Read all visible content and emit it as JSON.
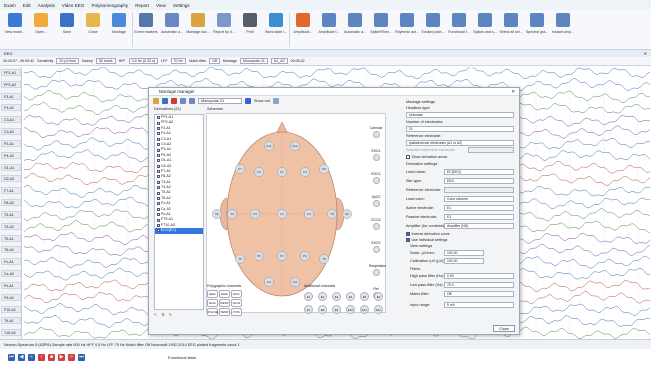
{
  "menu": [
    "Exam",
    "Edit",
    "Analysis",
    "Video EEG",
    "Polysomnography",
    "Report",
    "View",
    "Settings"
  ],
  "ribbon": [
    {
      "label": "New exam...",
      "color": "#3a7bd5"
    },
    {
      "label": "Open...",
      "color": "#f2a93b"
    },
    {
      "label": "Save",
      "color": "#3b72c4"
    },
    {
      "label": "Close",
      "color": "#e8b64c"
    },
    {
      "label": "Montage",
      "color": "#4a8ad8"
    },
    {
      "label": "Event markers",
      "color": "#5577aa"
    },
    {
      "label": "Automatic a...",
      "color": "#6a88c4"
    },
    {
      "label": "Montage wiz...",
      "color": "#d9a441"
    },
    {
      "label": "Report by d...",
      "color": "#7a99c9"
    },
    {
      "label": "Print",
      "color": "#555e6a"
    },
    {
      "label": "Work table i...",
      "color": "#3d8ed0"
    },
    {
      "label": "Amplitude...",
      "color": "#e06a2c"
    },
    {
      "label": "Amplitude t...",
      "color": "#5b86c0"
    },
    {
      "label": "Automatic a...",
      "color": "#5b86c0"
    },
    {
      "label": "Spike/Rhim...",
      "color": "#5b86c0"
    },
    {
      "label": "Rhythmic act...",
      "color": "#5b86c0"
    },
    {
      "label": "Evoked pote...",
      "color": "#5b86c0"
    },
    {
      "label": "Functional t...",
      "color": "#5b86c0"
    },
    {
      "label": "Spikes and s...",
      "color": "#5b86c0"
    },
    {
      "label": "Select all sel...",
      "color": "#5b86c0"
    },
    {
      "label": "Spectral gra...",
      "color": "#5b86c0"
    },
    {
      "label": "Instant amp...",
      "color": "#5b86c0"
    }
  ],
  "tab": {
    "label": "EEG",
    "close": "✕"
  },
  "toolbar2": {
    "time": "00:05:07 - 00:05:42",
    "sensitivity_label": "Sensitivity",
    "sensitivity": "20 μV/mm",
    "sweep_label": "Sweep",
    "sweep": "30 mm/s",
    "hff_label": "HFF",
    "hff": "0.5 Hz (0.32 s)",
    "lff_label": "LFF",
    "lff": "70 Hz",
    "notch_label": "Notch filter",
    "notch": "Off",
    "montage_label": "Montage",
    "montage": "Monopolar 21",
    "ref": "A1_A2",
    "marker": "00:05:42"
  },
  "channels": [
    "FP1-A1",
    "FP2-A2",
    "F3-A1",
    "F4-A2",
    "C3-A1",
    "C4-A2",
    "P3-A1",
    "P4-A2",
    "O1-A1",
    "O2-A2",
    "F7-A1",
    "F8-A2",
    "T3-A1",
    "T4-A2",
    "T5-A1",
    "T6-A2",
    "Fz-A1",
    "Cz-A2",
    "Pz-A1",
    "F9-A2",
    "F10-A2",
    "T9-A1",
    "T10-A2"
  ],
  "status": "Neuron-Spectrum-5 (63PM)  Sample rate 500 Hz  HFF 0.5 Hz  LFF 70 Hz  Notch filter Off  Neurosoft 1992-2014 EEG plotted fragments count 1",
  "player": {
    "label": "Functional tests"
  },
  "dialog": {
    "title": "Montage manager",
    "close": "✕",
    "montage": "Monopolar 21",
    "showout": "Show out",
    "derivations_label": "Derivations (22)",
    "derivations": [
      "FP1-A1",
      "FP2-A2",
      "F3-A1",
      "F4-A2",
      "C3-A1",
      "C4-A2",
      "P3-A1",
      "P4-A2",
      "O1-A1",
      "O2-A2",
      "F7-A1",
      "F8-A2",
      "T3-A1",
      "T4-A2",
      "T5-A1",
      "T6-A2",
      "Fz-A1",
      "Cz-A2",
      "Pz-A1",
      "FT9-A1",
      "FT10-A2",
      "ECG(EC)"
    ],
    "selected_index": 21,
    "schemes_label": "Schemes",
    "side": [
      "Cannula",
      "EKG1",
      "EOG1",
      "SpO2",
      "ECG2",
      "EKG2",
      "Respiration",
      "Ref"
    ],
    "head_electrodes": [
      "Fp1",
      "Fp2",
      "F7",
      "F3",
      "Fz",
      "F4",
      "F8",
      "T3",
      "C3",
      "Cz",
      "C4",
      "T4",
      "T5",
      "P3",
      "Pz",
      "P4",
      "T6",
      "O1",
      "O2",
      "A1",
      "A2"
    ],
    "poly_label": "Polygraphic channels",
    "poly_btns": [
      "EEG",
      "EMG",
      "ECG",
      "EOG",
      "RESP",
      "SpO2",
      "PULSE",
      "TEMP",
      "POS"
    ],
    "additional_label": "Additional channels",
    "additional": [
      "E1",
      "E2",
      "E3",
      "E4",
      "E5",
      "E6",
      "E7",
      "E8",
      "E9",
      "E10",
      "E11",
      "E12"
    ],
    "settings_title": "Montage settings",
    "headbox_type_label": "Headbox type:",
    "headbox_type": "Unknown",
    "num_electrodes_label": "Number of electrodes:",
    "num_electrodes": "21",
    "ref_electrode_label": "Reference electrode:",
    "ref_electrode": "Ipsilateral ear electrodes (A1 or A2)",
    "sel_ref_label": "Selected reference electrode:",
    "show_deriv_label": "Show derivation arrow",
    "deriv_settings": "Derivation settings",
    "lead_name_label": "Lead name:",
    "lead_name": "EC(EEG)",
    "site_type_label": "Site type:",
    "site_type": "EEG",
    "ref_elec2_label": "Reference electrode:",
    "lead_color_label": "Lead color:",
    "lead_color": "Color scheme",
    "active_label": "Active electrode:",
    "active": "E1",
    "passive_label": "Passive electrode:",
    "passive": "E1",
    "amplifier_label": "Amplifier (for combine):",
    "amplifier": "Amplifier (NS)",
    "invert_label": "Inverse derivation curve",
    "individual_label": "Use individual settings",
    "view_label": "View settings",
    "scale_label": "Scale, μV/mm:",
    "scale": "100.00",
    "calib_label": "Calibration (uV (μV)):",
    "calib": "100.00",
    "filters_label": "Filters",
    "hpf_label": "High pass filter (Hz):",
    "hpf": "0.50",
    "lpf_label": "Low pass filter (Hz):",
    "lpf": "75.0",
    "mains_label": "Mains filter:",
    "mains": "Off",
    "input_label": "Input range:",
    "input": "5 mV",
    "close_btn": "Close"
  }
}
